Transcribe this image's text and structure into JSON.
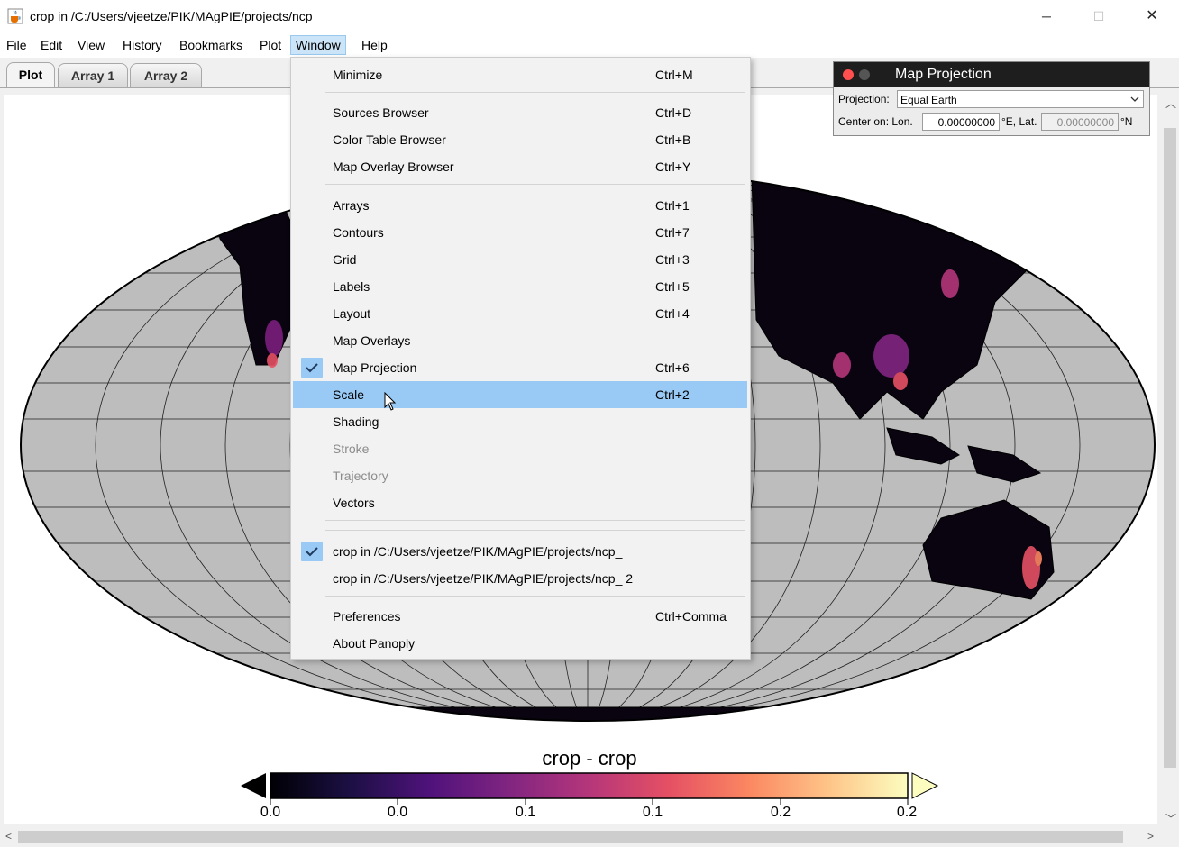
{
  "window": {
    "title": "crop in /C:/Users/vjeetze/PIK/MAgPIE/projects/ncp_",
    "app_icon": "java-coffee-cup-icon",
    "controls": {
      "minimize": "─",
      "maximize": "☐",
      "close": "✕"
    }
  },
  "menubar": {
    "items": [
      "File",
      "Edit",
      "View",
      "History",
      "Bookmarks",
      "Plot",
      "Window",
      "Help"
    ],
    "active": "Window"
  },
  "tabs": [
    "Plot",
    "Array 1",
    "Array 2"
  ],
  "window_menu": {
    "items": [
      {
        "label": "Minimize",
        "shortcut": "Ctrl+M"
      },
      {
        "label": "Sources Browser",
        "shortcut": "Ctrl+D"
      },
      {
        "label": "Color Table Browser",
        "shortcut": "Ctrl+B"
      },
      {
        "label": "Map Overlay Browser",
        "shortcut": "Ctrl+Y"
      },
      {
        "label": "Arrays",
        "shortcut": "Ctrl+1"
      },
      {
        "label": "Contours",
        "shortcut": "Ctrl+7"
      },
      {
        "label": "Grid",
        "shortcut": "Ctrl+3"
      },
      {
        "label": "Labels",
        "shortcut": "Ctrl+5"
      },
      {
        "label": "Layout",
        "shortcut": "Ctrl+4"
      },
      {
        "label": "Map Overlays",
        "shortcut": ""
      },
      {
        "label": "Map Projection",
        "shortcut": "Ctrl+6",
        "checked": true
      },
      {
        "label": "Scale",
        "shortcut": "Ctrl+2",
        "highlighted": true
      },
      {
        "label": "Shading",
        "shortcut": ""
      },
      {
        "label": "Stroke",
        "shortcut": "",
        "disabled": true
      },
      {
        "label": "Trajectory",
        "shortcut": "",
        "disabled": true
      },
      {
        "label": "Vectors",
        "shortcut": ""
      },
      {
        "label": "crop in /C:/Users/vjeetze/PIK/MAgPIE/projects/ncp_",
        "shortcut": "",
        "checked": true
      },
      {
        "label": "crop in /C:/Users/vjeetze/PIK/MAgPIE/projects/ncp_ 2",
        "shortcut": ""
      },
      {
        "label": "Preferences",
        "shortcut": "Ctrl+Comma"
      },
      {
        "label": "About Panoply",
        "shortcut": ""
      }
    ]
  },
  "map_projection_panel": {
    "title": "Map Projection",
    "projection_label": "Projection:",
    "projection_value": "Equal Earth",
    "center_label": "Center on: Lon.",
    "lon_value": "0.00000000",
    "lon_unit": "°E, Lat.",
    "lat_value": "0.00000000",
    "lat_unit": "°N"
  },
  "colorbar": {
    "title": "crop - crop",
    "ticks": [
      "0.0",
      "0.0",
      "0.1",
      "0.1",
      "0.2",
      "0.2"
    ],
    "colors": [
      "#000004",
      "#1c1044",
      "#4f127b",
      "#812581",
      "#b5367a",
      "#e55064",
      "#fb8761",
      "#fec488",
      "#fcfdbf"
    ]
  },
  "icons": {
    "check": "checkmark-icon",
    "cursor": "mouse-pointer-icon",
    "dropdown": "chevron-down-icon"
  }
}
